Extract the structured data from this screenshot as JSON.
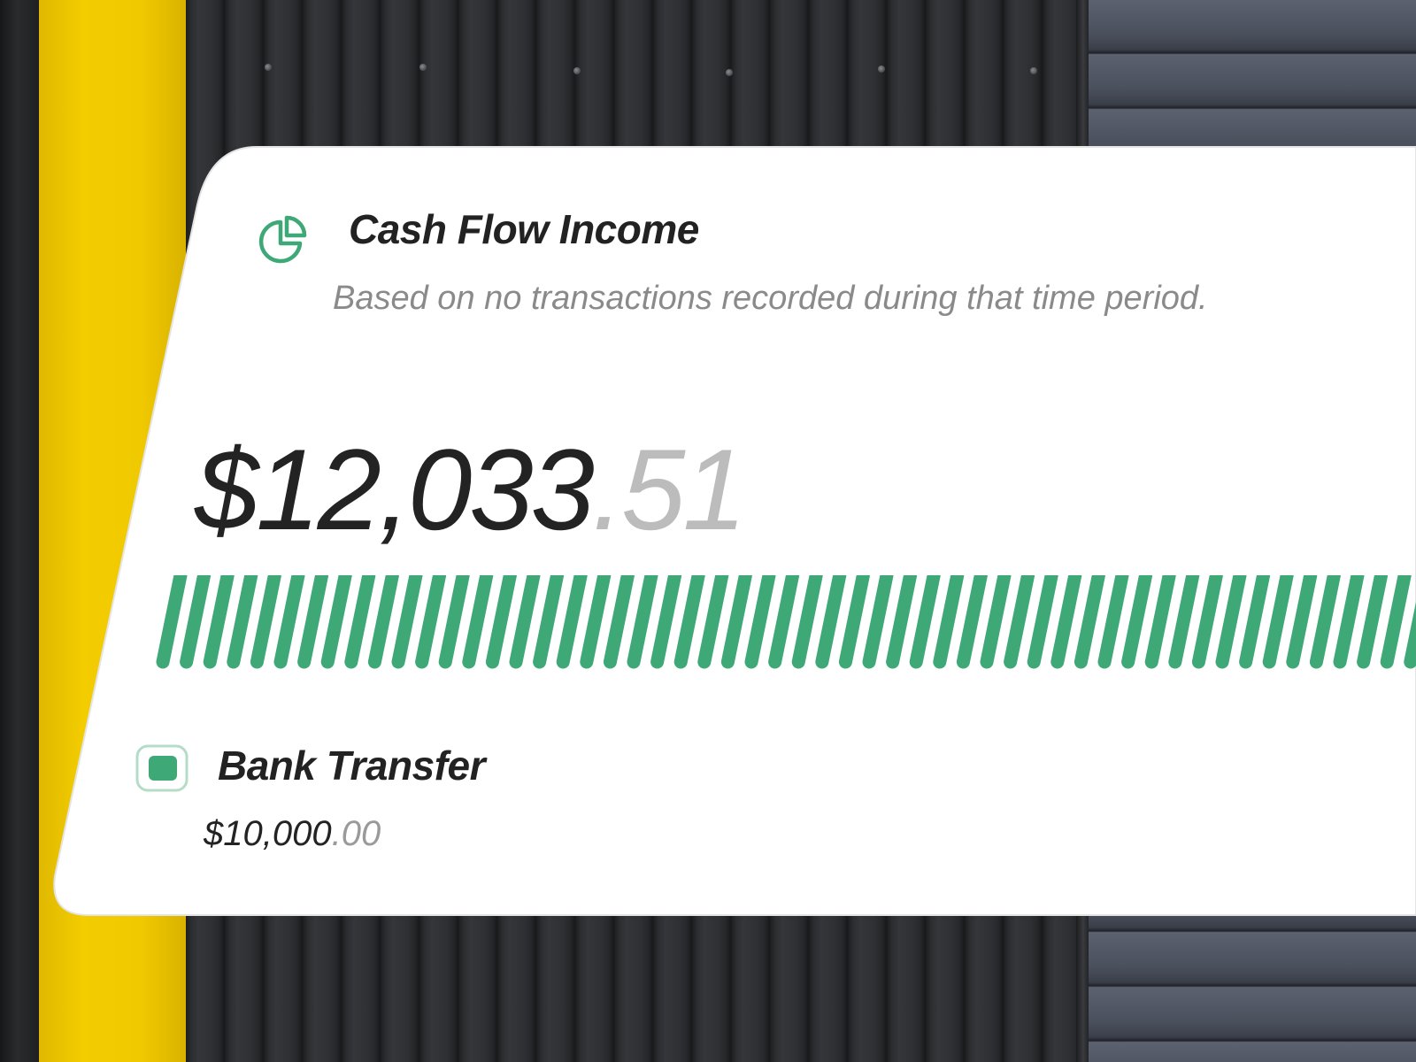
{
  "card": {
    "title": "Cash Flow Income",
    "subtitle": "Based on no transactions recorded during that time period.",
    "icon": "pie-chart-icon",
    "total_amount": {
      "whole": "$12,033",
      "cents": ".51"
    }
  },
  "legend": [
    {
      "label": "Bank Transfer",
      "amount": {
        "whole": "$10,000",
        "cents": ".00"
      },
      "color": "#3fa877"
    }
  ],
  "colors": {
    "accent": "#3fa877",
    "card_background": "#ffffff",
    "text_primary": "#222222",
    "text_muted": "#8a8a8a"
  }
}
